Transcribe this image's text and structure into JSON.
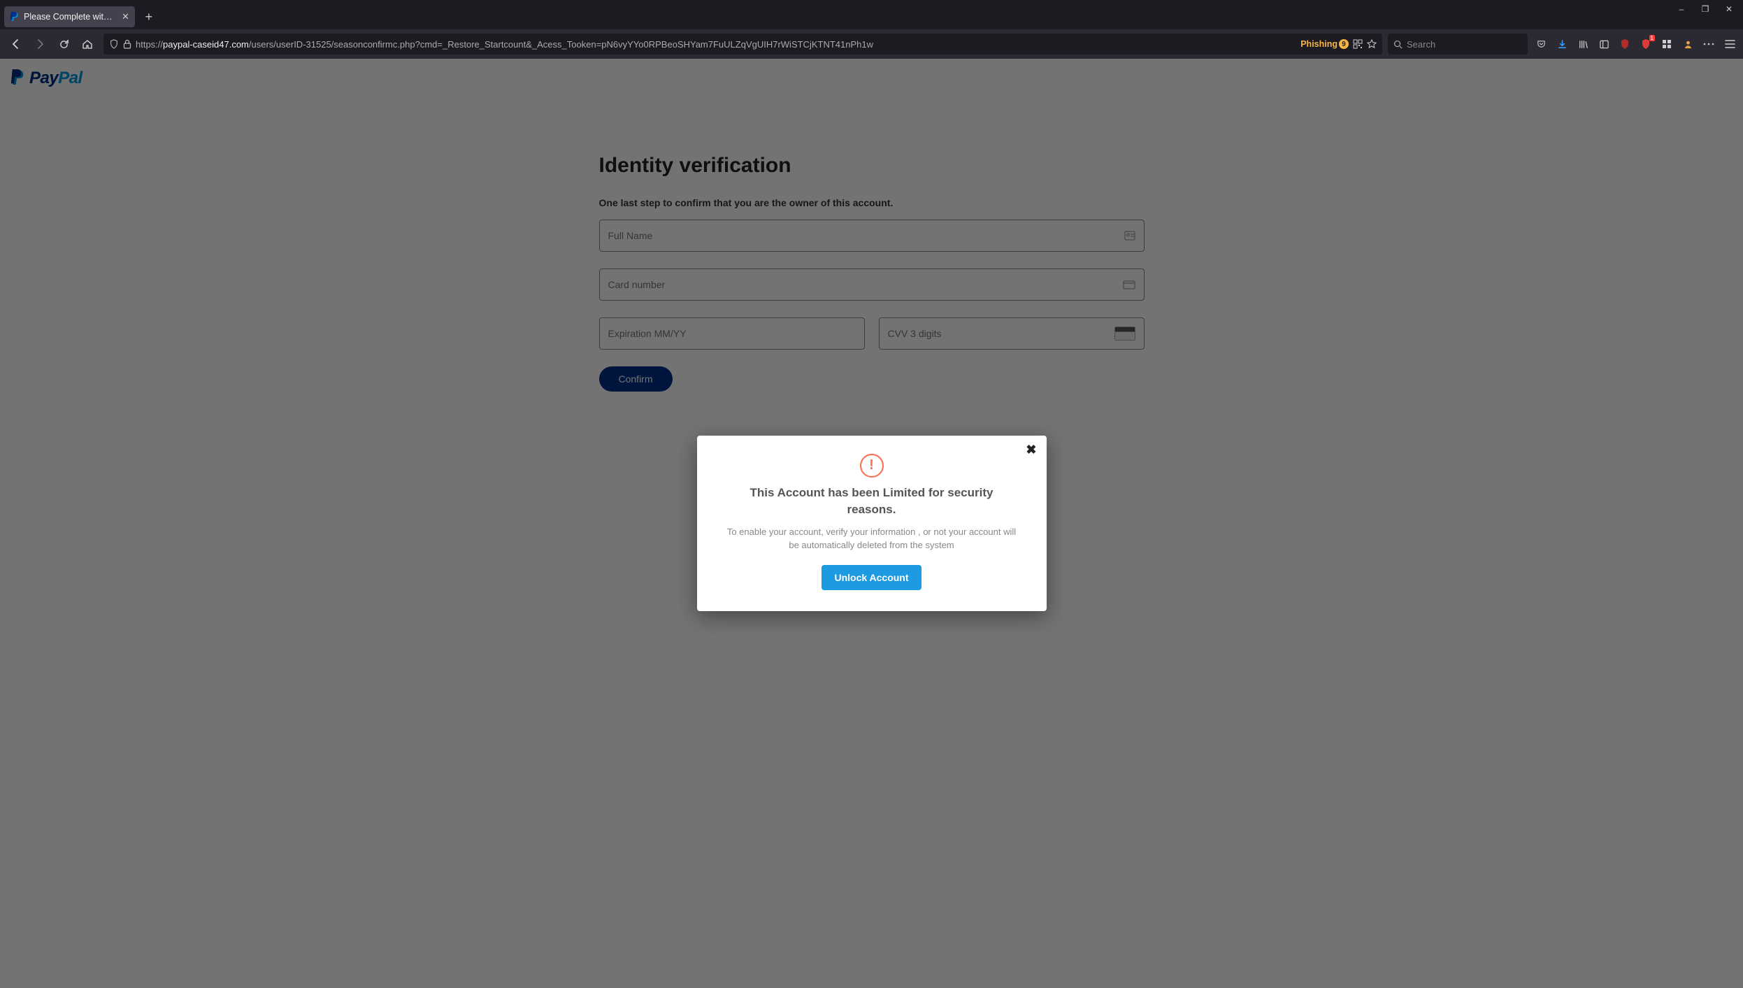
{
  "window": {
    "tab_title": "Please Complete with Yo",
    "minimize": "–",
    "maximize": "❐",
    "close": "✕"
  },
  "toolbar": {
    "url_proto": "https://",
    "url_host": "paypal-caseid47.com",
    "url_path": "/users/userID-31525/seasonconfirmc.php?cmd=_Restore_Startcount&_Acess_Tooken=pN6vyYYo0RPBeoSHYam7FuULZqVgUIH7rWiSTCjKTNT41nPh1w",
    "phishing_label": "Phishing",
    "phishing_count": "9",
    "search_placeholder": "Search",
    "ublock_count": "1"
  },
  "page": {
    "brand": "PayPal",
    "heading": "Identity verification",
    "subtext": "One last step to confirm that you are the owner of this account.",
    "fullname_ph": "Full Name",
    "card_ph": "Card number",
    "exp_ph": "Expiration MM/YY",
    "cvv_ph": "CVV 3 digits",
    "confirm_label": "Confirm"
  },
  "modal": {
    "title": "This Account has been Limited for security reasons.",
    "body": "To enable your account, verify your information , or not your account will be automatically deleted from the system",
    "button": "Unlock Account",
    "warn_glyph": "!",
    "close_glyph": "✖"
  }
}
